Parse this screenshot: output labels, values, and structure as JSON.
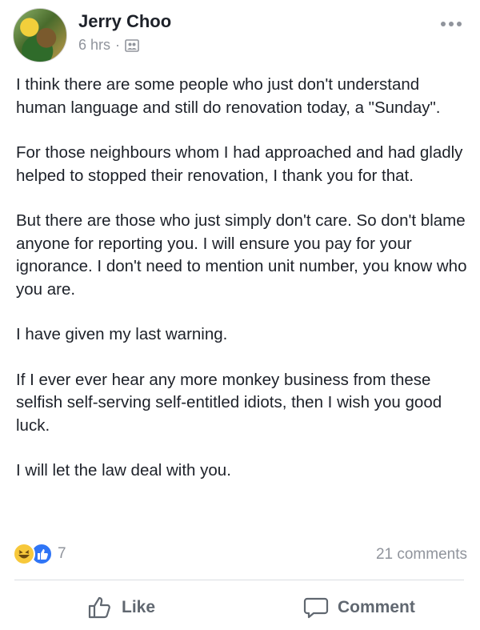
{
  "post": {
    "author": "Jerry Choo",
    "time": "6 hrs",
    "separator": "·",
    "audience_icon": "friends-icon",
    "paragraphs": [
      "I think there are some people who just don't understand human language and still do renovation today, a \"Sunday\".",
      "For those neighbours whom I had approached and had gladly helped to stopped their renovation, I thank you for that.",
      "But there are those who just simply don't care. So don't blame anyone for reporting you. I will ensure you pay for your ignorance. I don't need to mention unit number, you know who you are.",
      "I have given my last warning.",
      "If I ever ever hear any more monkey business from these selfish self-serving self-entitled idiots, then I wish you good luck.",
      "I will let the law deal with you."
    ]
  },
  "stats": {
    "reaction_count": "7",
    "comments": "21 comments",
    "reaction_icons": [
      "haha-icon",
      "like-icon"
    ]
  },
  "actions": {
    "like_label": "Like",
    "comment_label": "Comment"
  },
  "colors": {
    "text": "#1d2129",
    "muted": "#90949c",
    "action": "#606770",
    "like_blue": "#2f75f6",
    "haha_yellow": "#f7c83b"
  }
}
